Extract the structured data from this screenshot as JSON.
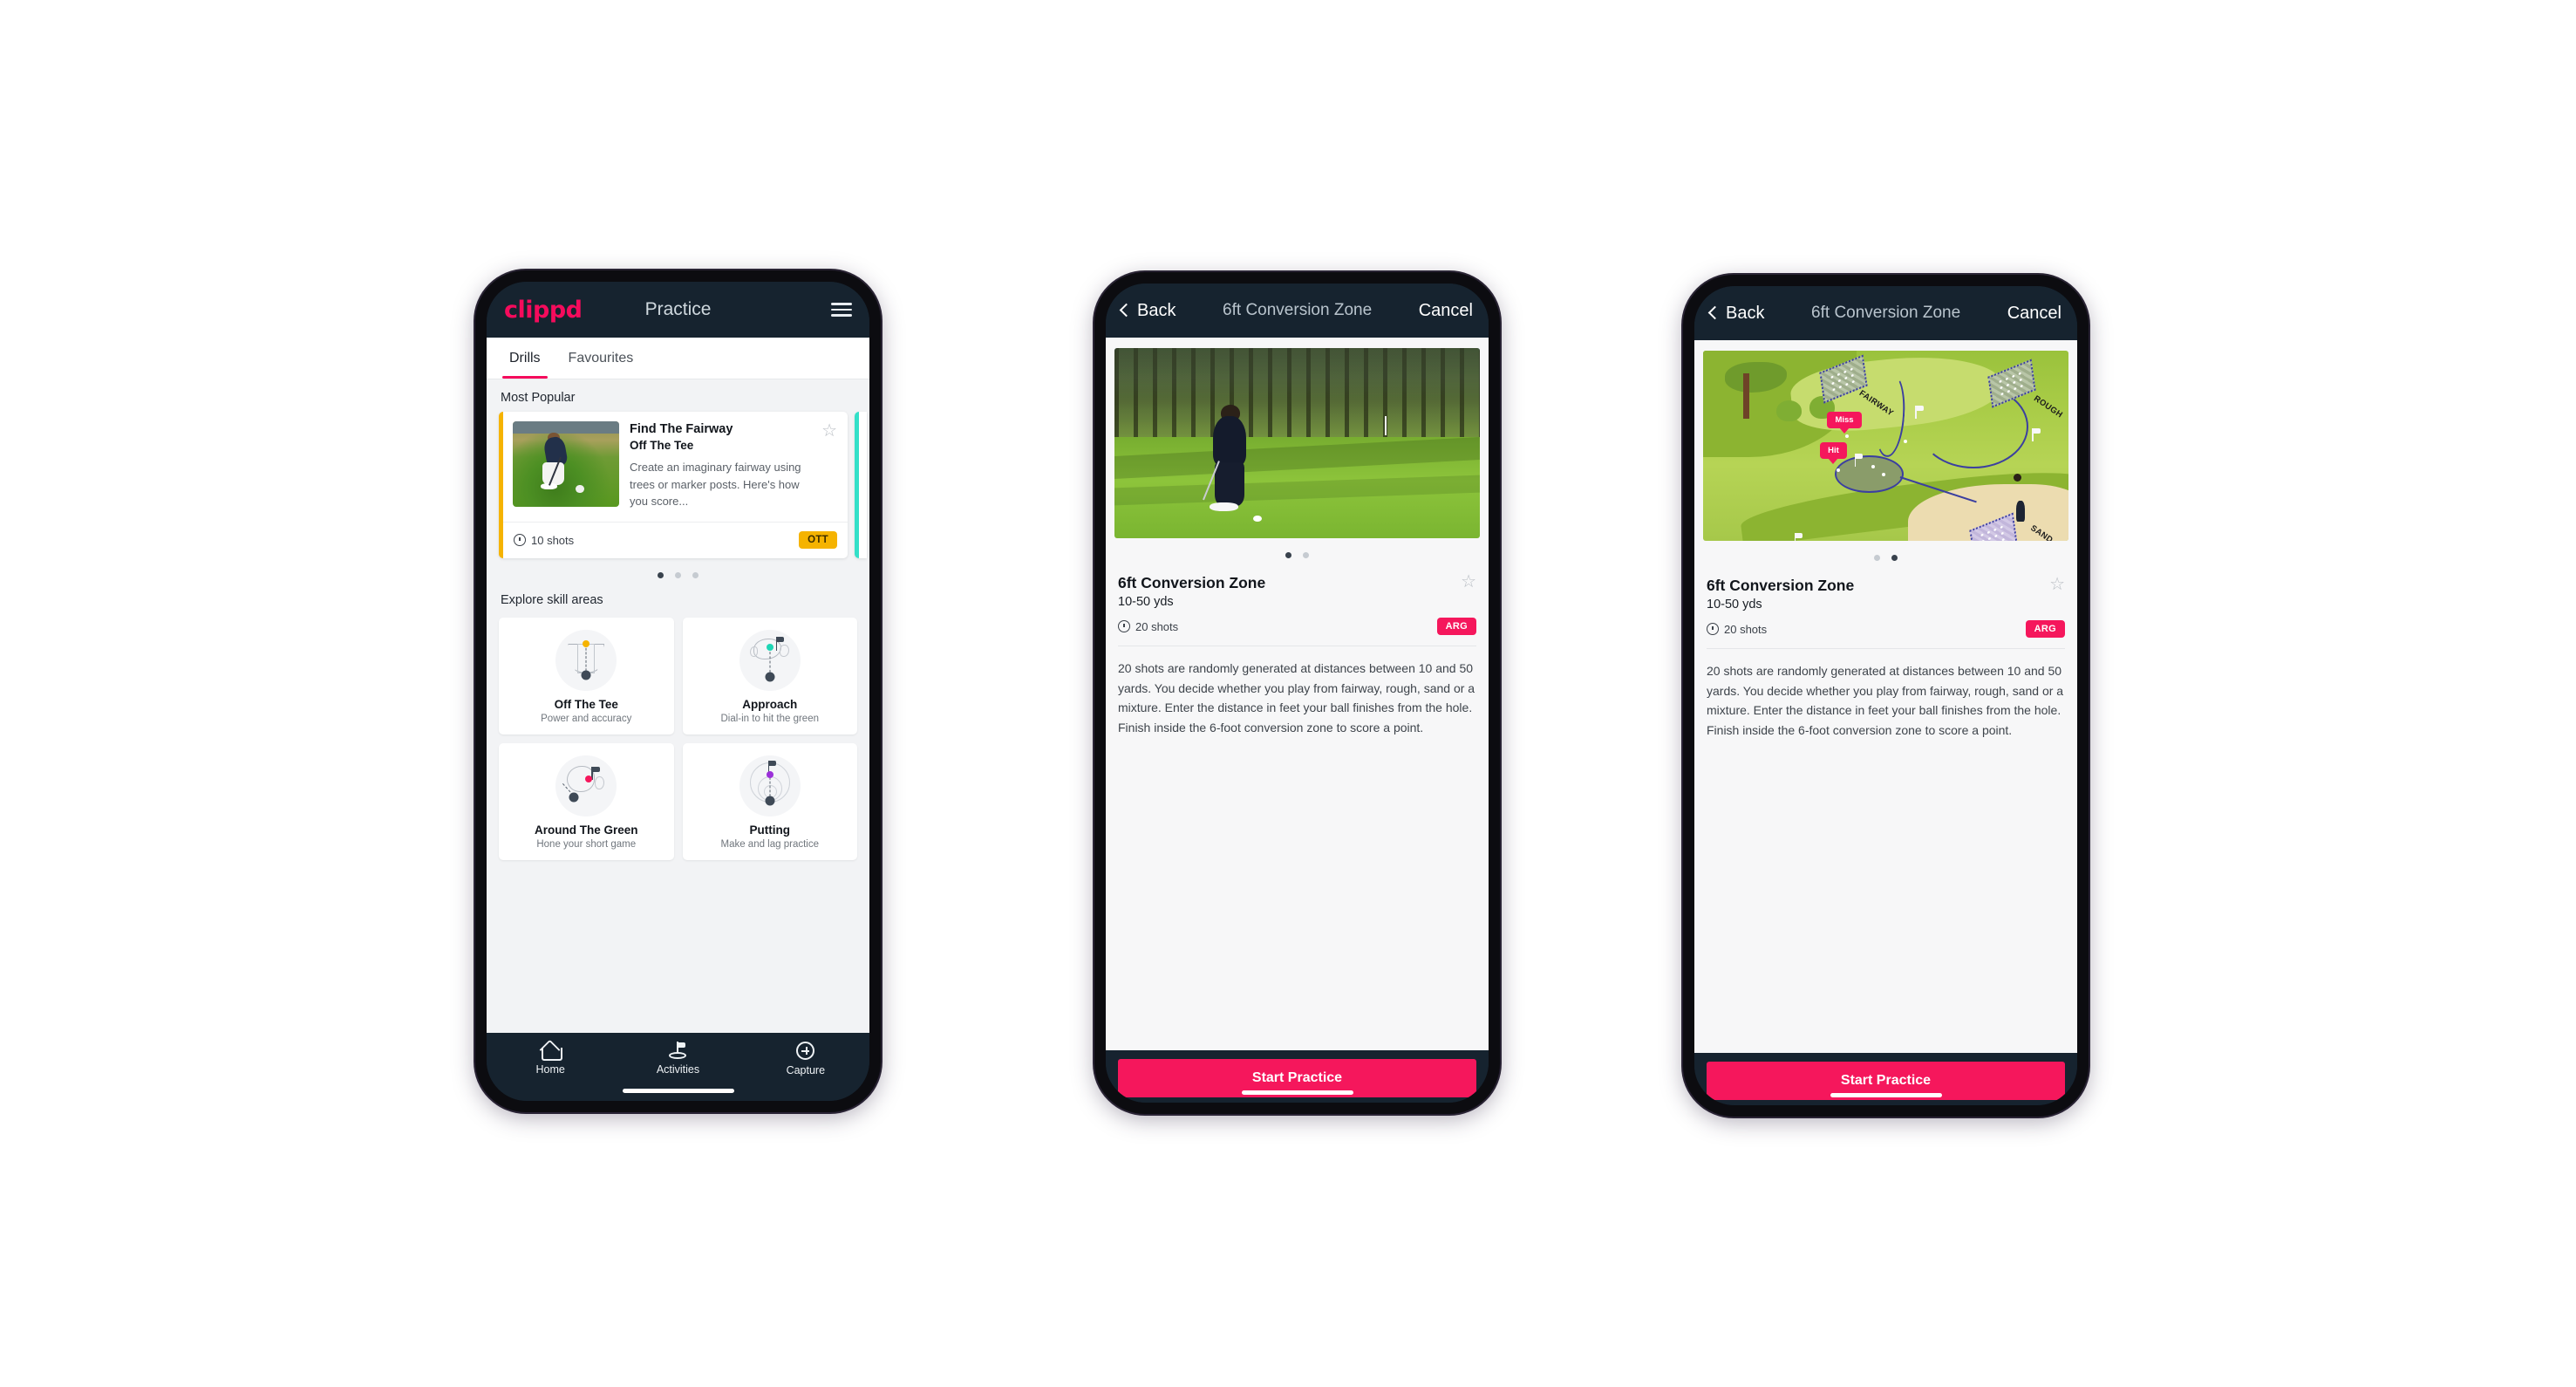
{
  "phone1": {
    "header": {
      "brand": "clippd",
      "title": "Practice",
      "menu_icon": "hamburger-icon"
    },
    "tabs": [
      {
        "label": "Drills",
        "active": true
      },
      {
        "label": "Favourites",
        "active": false
      }
    ],
    "sections": {
      "most_popular_label": "Most Popular",
      "explore_label": "Explore skill areas"
    },
    "drill_card": {
      "title": "Find The Fairway",
      "subtitle": "Off The Tee",
      "description": "Create an imaginary fairway using trees or marker posts. Here's how you score...",
      "shots": "10 shots",
      "tag": "OTT",
      "tag_color": "#f5b301",
      "accent_color": "#f5b301",
      "next_card_accent": "#33e0c8",
      "favourite_icon": "star-outline-icon"
    },
    "carousel_dots": {
      "count": 3,
      "active_index": 0
    },
    "skill_areas": [
      {
        "name": "Off The Tee",
        "subtitle": "Power and accuracy",
        "accent": "#f5b301"
      },
      {
        "name": "Approach",
        "subtitle": "Dial-in to hit the green",
        "accent": "#1ed6b5"
      },
      {
        "name": "Around The Green",
        "subtitle": "Hone your short game",
        "accent": "#f5175c"
      },
      {
        "name": "Putting",
        "subtitle": "Make and lag practice",
        "accent": "#9b30d9"
      }
    ],
    "bottom_nav": [
      {
        "label": "Home",
        "icon": "home-icon",
        "active": false
      },
      {
        "label": "Activities",
        "icon": "golf-flag-icon",
        "active": true
      },
      {
        "label": "Capture",
        "icon": "plus-circle-icon",
        "active": false
      }
    ]
  },
  "phone2": {
    "nav": {
      "back": "Back",
      "title": "6ft Conversion Zone",
      "cancel": "Cancel",
      "back_icon": "chevron-left-icon"
    },
    "media_type": "photo",
    "carousel_dots": {
      "count": 2,
      "active_index": 0
    },
    "detail": {
      "title": "6ft Conversion Zone",
      "yards": "10-50 yds",
      "shots": "20 shots",
      "tag": "ARG",
      "tag_color": "#f5175c",
      "favourite_icon": "star-outline-icon",
      "description": "20 shots are randomly generated at distances between 10 and 50 yards. You decide whether you play from fairway, rough, sand or a mixture. Enter the distance in feet your ball finishes from the hole. Finish inside the 6-foot conversion zone to score a point."
    },
    "cta": {
      "label": "Start Practice",
      "color": "#f5175c"
    }
  },
  "phone3": {
    "nav": {
      "back": "Back",
      "title": "6ft Conversion Zone",
      "cancel": "Cancel",
      "back_icon": "chevron-left-icon"
    },
    "media_type": "diagram",
    "diagram_labels": {
      "fairway": "FAIRWAY",
      "rough": "ROUGH",
      "sand": "SAND",
      "miss": "Miss",
      "hit": "Hit"
    },
    "carousel_dots": {
      "count": 2,
      "active_index": 1
    },
    "detail": {
      "title": "6ft Conversion Zone",
      "yards": "10-50 yds",
      "shots": "20 shots",
      "tag": "ARG",
      "tag_color": "#f5175c",
      "favourite_icon": "star-outline-icon",
      "description": "20 shots are randomly generated at distances between 10 and 50 yards. You decide whether you play from fairway, rough, sand or a mixture. Enter the distance in feet your ball finishes from the hole. Finish inside the 6-foot conversion zone to score a point."
    },
    "cta": {
      "label": "Start Practice",
      "color": "#f5175c"
    }
  }
}
